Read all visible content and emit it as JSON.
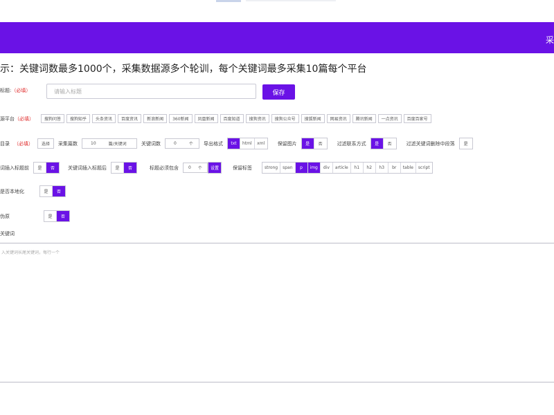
{
  "header": {
    "right_text": "采"
  },
  "notice": "示：关键词数最多1000个，采集数据源多个轮训，每个关键词最多采集10篇每个平台",
  "title_row": {
    "label": "标题:",
    "required": "（必填）",
    "input_placeholder": "请输入标题",
    "save_label": "保存"
  },
  "source_row": {
    "label": "源平台",
    "required": "（必填）",
    "platforms": [
      {
        "label": "搜狗问答",
        "selected": false
      },
      {
        "label": "搜狗知乎",
        "selected": false
      },
      {
        "label": "头条资讯",
        "selected": false
      },
      {
        "label": "百度资讯",
        "selected": false
      },
      {
        "label": "新浪新闻",
        "selected": false
      },
      {
        "label": "360新闻",
        "selected": false
      },
      {
        "label": "凤凰新闻",
        "selected": false
      },
      {
        "label": "百度知道",
        "selected": false
      },
      {
        "label": "搜狗资讯",
        "selected": false
      },
      {
        "label": "搜狗公众号",
        "selected": false
      },
      {
        "label": "搜狐新闻",
        "selected": false
      },
      {
        "label": "网易资讯",
        "selected": false
      },
      {
        "label": "腾讯新闻",
        "selected": false
      },
      {
        "label": "一点资讯",
        "selected": false
      },
      {
        "label": "百度百家号",
        "selected": false
      }
    ]
  },
  "config_row": {
    "label": "目录",
    "required": "（必填）",
    "select_btn": "选择",
    "collect_label": "采集篇数",
    "collect_value": "10",
    "collect_unit": "篇/关键词",
    "keyword_count_label": "关键词数",
    "keyword_count_value": "0",
    "keyword_count_unit": "个",
    "format_label": "导出格式",
    "formats": [
      {
        "label": "txt",
        "on": true
      },
      {
        "label": "html",
        "on": false
      },
      {
        "label": "xml",
        "on": false
      }
    ],
    "keep_image_label": "保留图片",
    "keep_image": [
      {
        "label": "是",
        "on": true
      },
      {
        "label": "否",
        "on": false
      }
    ],
    "filter_contact_label": "过滤联系方式",
    "filter_contact": [
      {
        "label": "是",
        "on": true
      },
      {
        "label": "否",
        "on": false
      }
    ],
    "filter_kw_label": "过滤关键词删除中段落",
    "filter_kw": [
      {
        "label": "是",
        "on": false
      }
    ]
  },
  "insert_row": {
    "label": "词插入标题前",
    "insert_front": [
      {
        "label": "是",
        "on": false
      },
      {
        "label": "否",
        "on": true
      }
    ],
    "insert_after_label": "关键词插入标题后",
    "insert_after": [
      {
        "label": "是",
        "on": false
      },
      {
        "label": "否",
        "on": true
      }
    ],
    "title_must_label": "标题必须包含",
    "title_must_value": "0",
    "title_must_unit": "个",
    "title_must_btn": "设置",
    "keep_tags_label": "保留标签",
    "tags": [
      {
        "label": "strong",
        "on": false
      },
      {
        "label": "span",
        "on": false
      },
      {
        "label": "p",
        "on": true
      },
      {
        "label": "img",
        "on": true
      },
      {
        "label": "div",
        "on": false
      },
      {
        "label": "article",
        "on": false
      },
      {
        "label": "h1",
        "on": false
      },
      {
        "label": "h2",
        "on": false
      },
      {
        "label": "h3",
        "on": false
      },
      {
        "label": "br",
        "on": false
      },
      {
        "label": "table",
        "on": false
      },
      {
        "label": "script",
        "on": false
      }
    ]
  },
  "localize_row": {
    "label": "是否本地化",
    "options": [
      {
        "label": "是",
        "on": false
      },
      {
        "label": "否",
        "on": true
      }
    ]
  },
  "pseudo_row": {
    "label": "伪原",
    "options": [
      {
        "label": "是",
        "on": false
      },
      {
        "label": "否",
        "on": true
      }
    ]
  },
  "keyword_row": {
    "label": "关键词",
    "placeholder": "入关键词长尾关键词，每行一个"
  }
}
